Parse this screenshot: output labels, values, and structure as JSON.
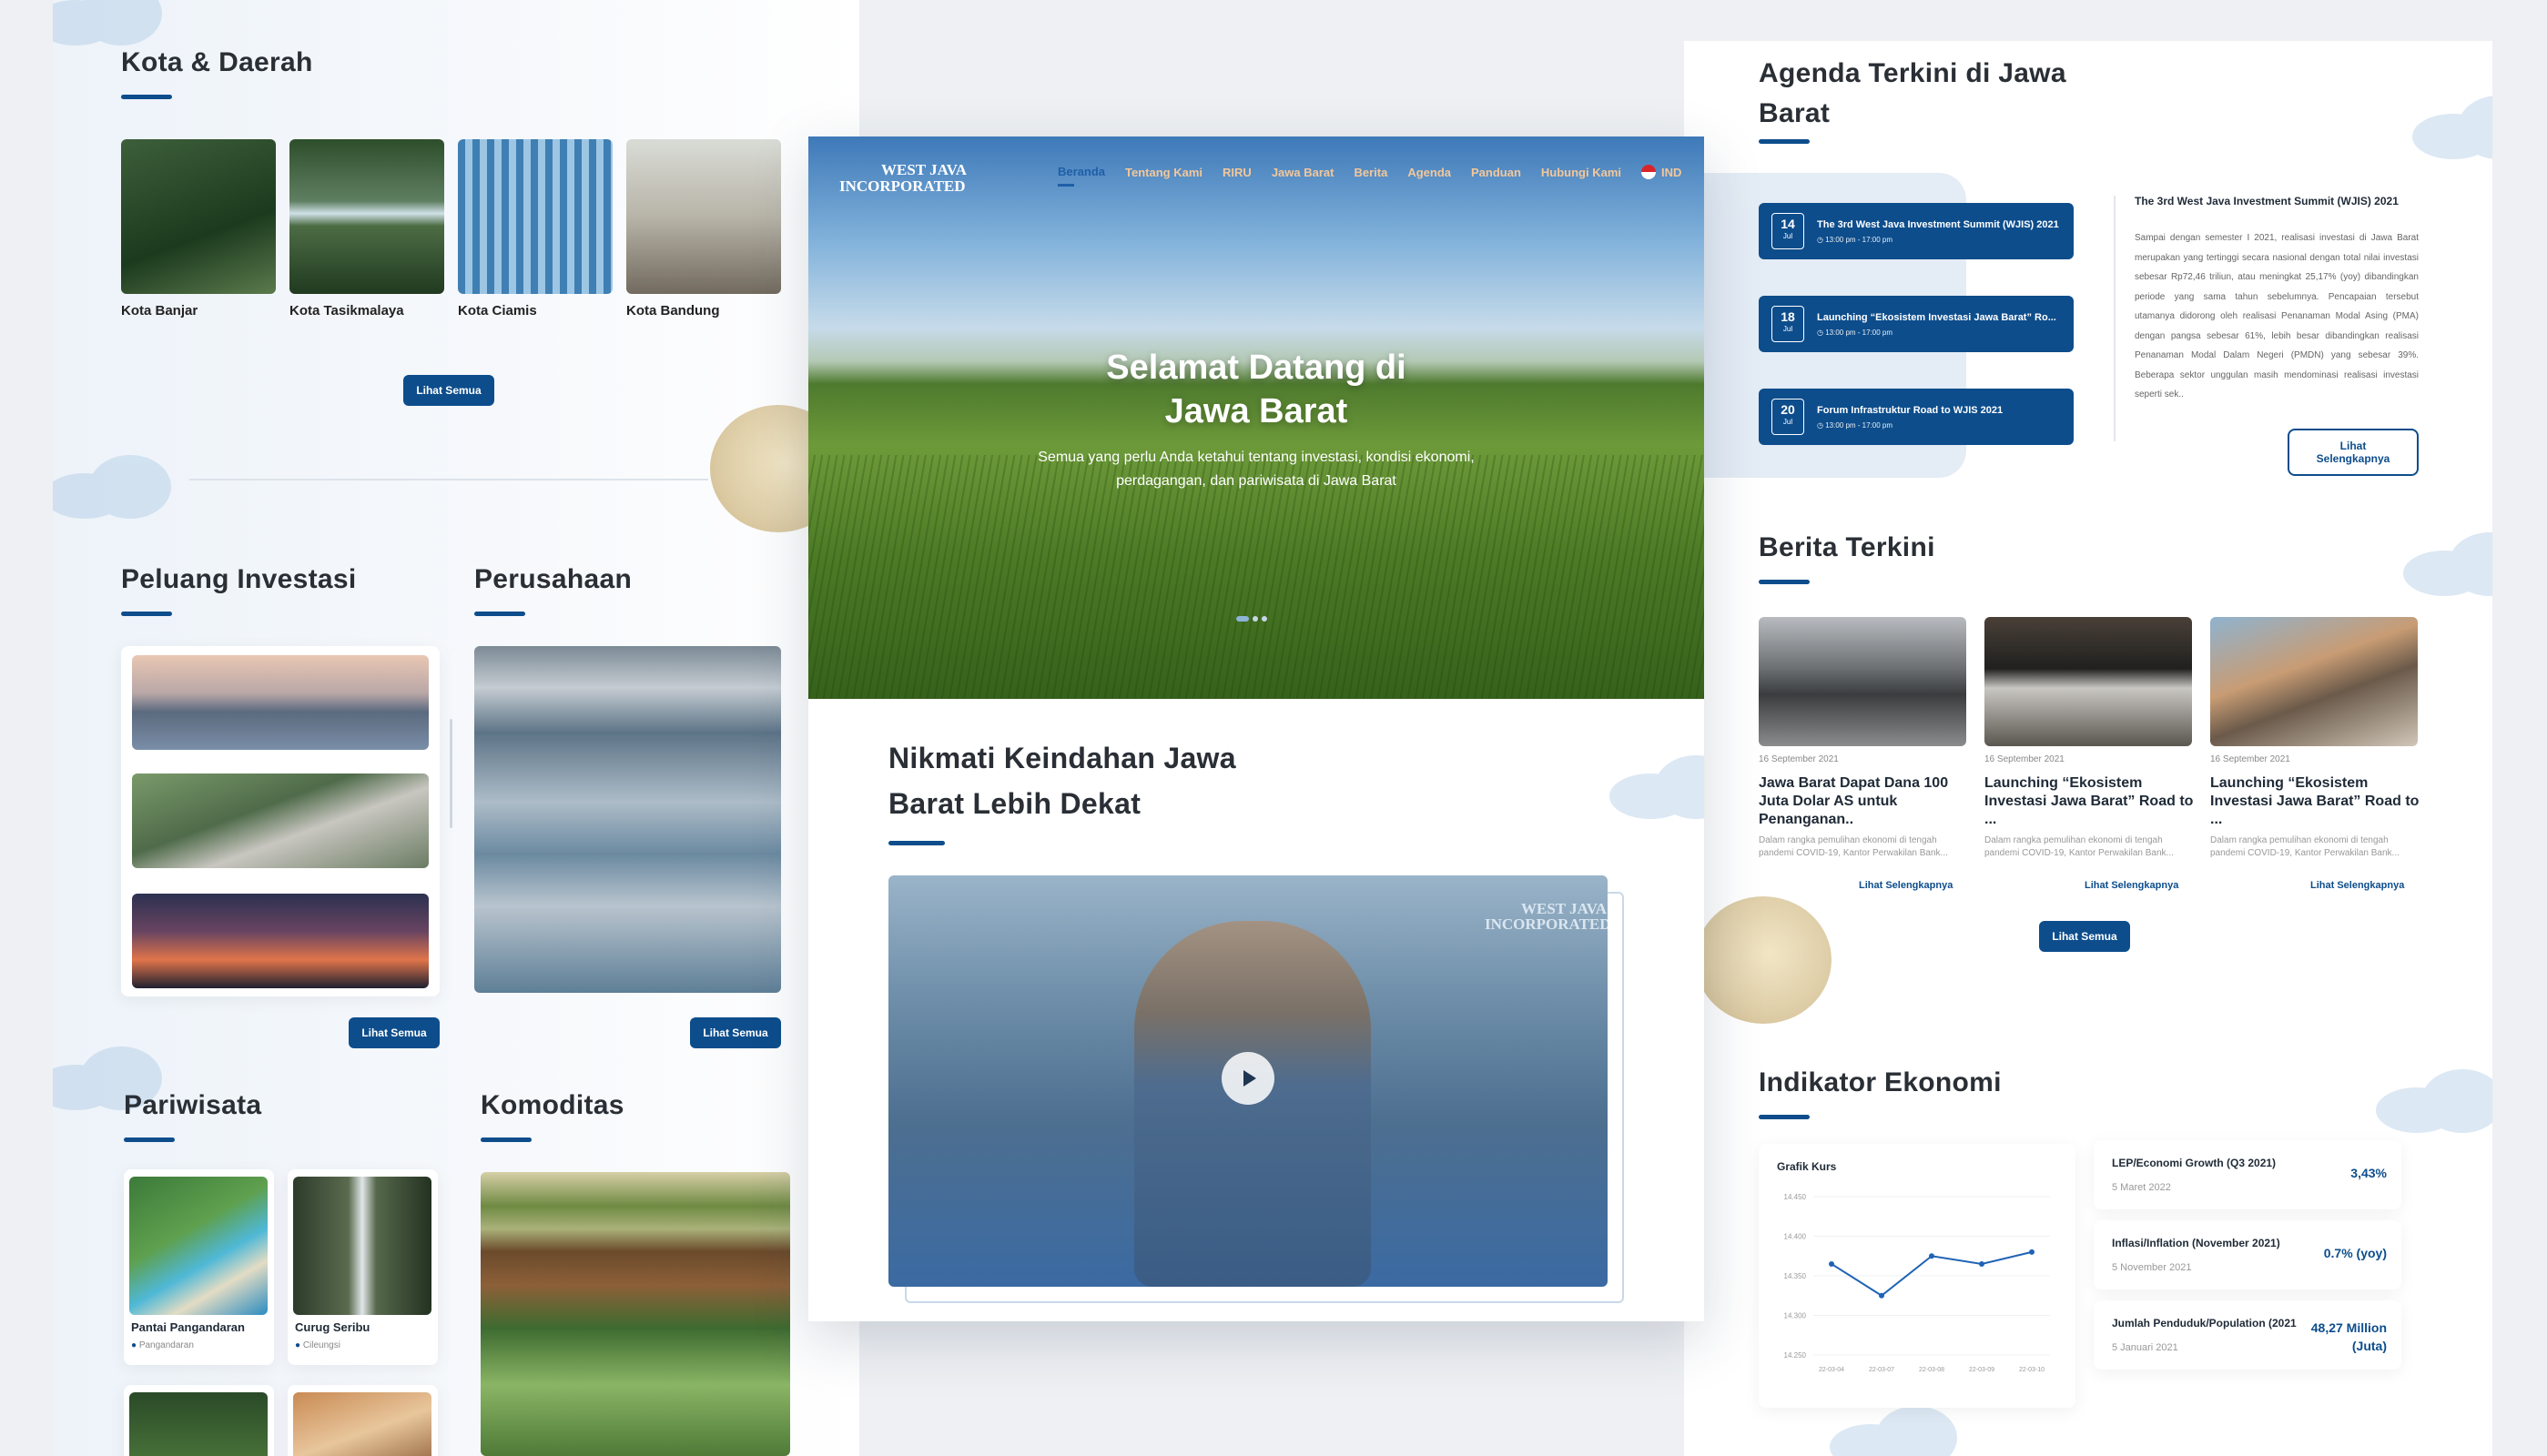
{
  "left": {
    "kota": {
      "title": "Kota & Daerah",
      "items": [
        {
          "label": "Kota Banjar"
        },
        {
          "label": "Kota Tasikmalaya"
        },
        {
          "label": "Kota Ciamis"
        },
        {
          "label": "Kota Bandung"
        }
      ],
      "button": "Lihat Semua"
    },
    "peluang": {
      "title": "Peluang Investasi",
      "button": "Lihat Semua"
    },
    "perusahaan": {
      "title": "Perusahaan",
      "button": "Lihat Semua"
    },
    "pariwisata": {
      "title": "Pariwisata",
      "items": [
        {
          "label": "Pantai Pangandaran",
          "location": "Pangandaran"
        },
        {
          "label": "Curug Seribu",
          "location": "Cileungsi"
        }
      ]
    },
    "komoditas": {
      "title": "Komoditas"
    }
  },
  "center": {
    "logo": {
      "line1": "WEST JAVA",
      "line2": "INCORPORATED"
    },
    "nav": [
      "Beranda",
      "Tentang Kami",
      "RIRU",
      "Jawa Barat",
      "Berita",
      "Agenda",
      "Panduan",
      "Hubungi Kami"
    ],
    "lang": "IND",
    "hero": {
      "title_line1": "Selamat Datang di",
      "title_line2": "Jawa Barat",
      "subtitle_line1": "Semua yang perlu Anda ketahui tentang investasi, kondisi ekonomi,",
      "subtitle_line2": "perdagangan, dan pariwisata di Jawa Barat"
    },
    "section": {
      "title_line1": "Nikmati Keindahan Jawa",
      "title_line2": "Barat Lebih Dekat"
    },
    "video_logo": {
      "line1": "WEST JAVA",
      "line2": "INCORPORATED"
    }
  },
  "right": {
    "agenda": {
      "title_line1": "Agenda Terkini di Jawa",
      "title_line2": "Barat",
      "items": [
        {
          "day": "14",
          "month": "Jul",
          "title": "The 3rd West Java Investment Summit (WJIS) 2021",
          "time": "13:00 pm - 17:00 pm"
        },
        {
          "day": "18",
          "month": "Jul",
          "title": "Launching “Ekosistem Investasi Jawa Barat” Ro...",
          "time": "13:00 pm - 17:00 pm"
        },
        {
          "day": "20",
          "month": "Jul",
          "title": "Forum Infrastruktur Road to WJIS 2021",
          "time": "13:00 pm - 17:00 pm"
        }
      ],
      "detail_title": "The 3rd West Java Investment Summit (WJIS) 2021",
      "detail_text": "Sampai dengan semester I 2021, realisasi investasi di Jawa Barat merupakan yang tertinggi secara nasional dengan total nilai investasi sebesar Rp72,46 triliun, atau meningkat 25,17% (yoy) dibandingkan periode yang sama tahun sebelumnya. Pencapaian tersebut utamanya didorong oleh realisasi Penanaman Modal Asing (PMA) dengan pangsa sebesar 61%, lebih besar dibandingkan realisasi Penanaman Modal Dalam Negeri (PMDN) yang sebesar 39%. Beberapa sektor unggulan masih mendominasi realisasi investasi seperti sek..",
      "detail_button": "Lihat Selengkapnya"
    },
    "berita": {
      "title": "Berita Terkini",
      "items": [
        {
          "date": "16 September 2021",
          "title": "Jawa Barat Dapat Dana 100 Juta Dolar AS untuk Penanganan..",
          "excerpt": "Dalam rangka pemulihan ekonomi di tengah pandemi COVID-19, Kantor Perwakilan Bank...",
          "more": "Lihat Selengkapnya"
        },
        {
          "date": "16 September 2021",
          "title": "Launching “Ekosistem Investasi Jawa Barat” Road to ...",
          "excerpt": "Dalam rangka pemulihan ekonomi di tengah pandemi COVID-19, Kantor Perwakilan Bank...",
          "more": "Lihat Selengkapnya"
        },
        {
          "date": "16 September 2021",
          "title": "Launching “Ekosistem Investasi Jawa Barat” Road to ...",
          "excerpt": "Dalam rangka pemulihan ekonomi di tengah pandemi COVID-19, Kantor Perwakilan Bank...",
          "more": "Lihat Selengkapnya"
        }
      ],
      "button": "Lihat Semua"
    },
    "indikator": {
      "title": "Indikator Ekonomi",
      "chart_title": "Grafik Kurs",
      "cards": [
        {
          "label": "LEP/Economi Growth (Q3 2021)",
          "date": "5 Maret 2022",
          "value": "3,43%"
        },
        {
          "label": "Inflasi/Inflation (November 2021)",
          "date": "5 November 2021",
          "value": "0.7% (yoy)"
        },
        {
          "label": "Jumlah Penduduk/Population (2021",
          "date": "5 Januari 2021",
          "value_line1": "48,27 Million",
          "value_line2": "(Juta)"
        }
      ]
    }
  },
  "chart_data": {
    "type": "line",
    "title": "Grafik Kurs",
    "y_ticks": [
      "14.450",
      "14.400",
      "14.350",
      "14.300",
      "14.250"
    ],
    "ylim": [
      14250,
      14450
    ],
    "x": [
      "22-03-04",
      "22-03-07",
      "22-03-08",
      "22-03-09",
      "22-03-10"
    ],
    "values": [
      14365,
      14325,
      14375,
      14365,
      14380
    ],
    "grid": true,
    "color": "#1f63b5"
  },
  "colors": {
    "brand": "#0d4d8c",
    "accent": "#f3c79a"
  }
}
